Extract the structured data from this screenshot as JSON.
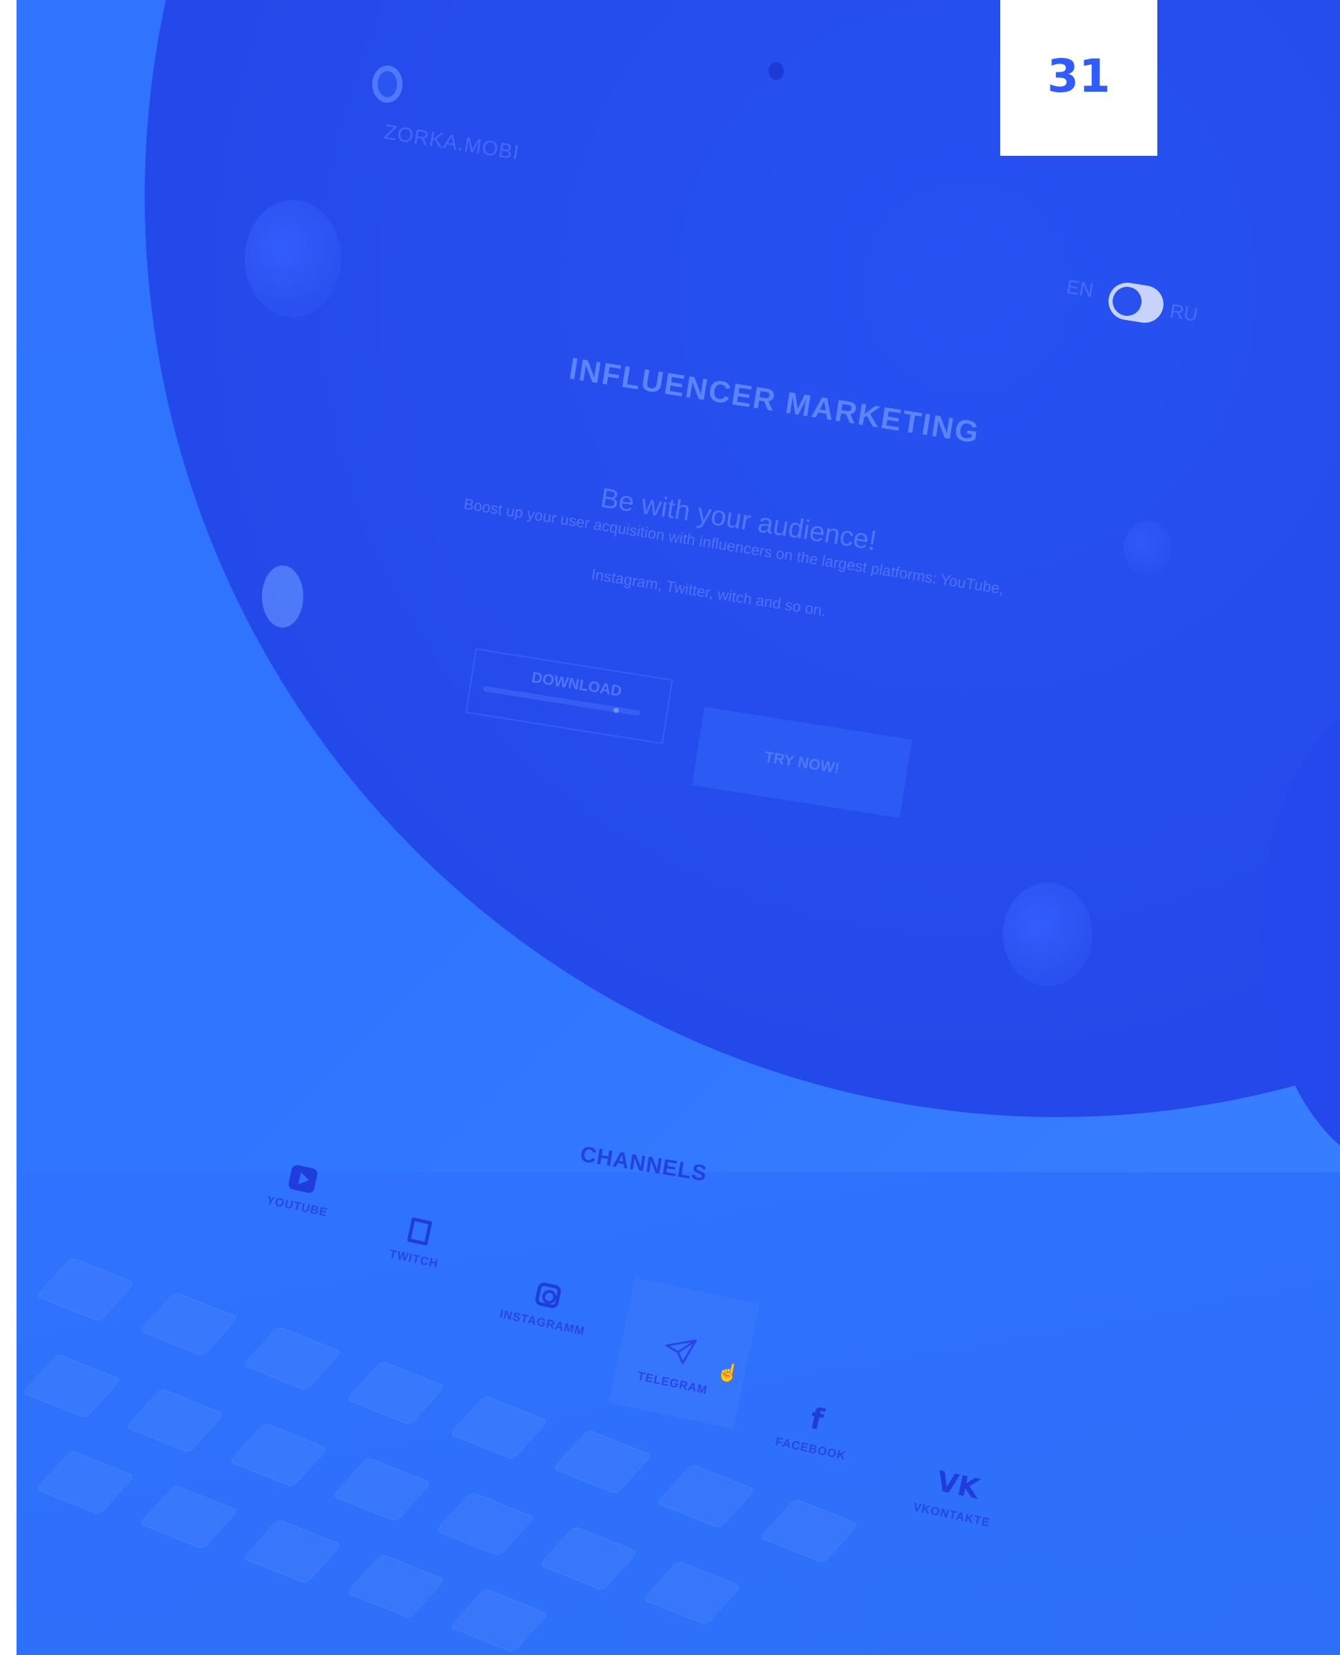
{
  "page_number": "31",
  "brand": {
    "name": "ZORKA.MOBI"
  },
  "language_toggle": {
    "left": "EN",
    "right": "RU"
  },
  "hero": {
    "title": "INFLUENCER MARKETING",
    "subtitle": "Be with your audience!",
    "description_line1": "Boost up your user acquisition with influencers on the largest platforms: YouTube,",
    "description_line2": "Instagram, Twitter, witch and so on.",
    "download_label": "DOWNLOAD",
    "try_label": "TRY NOW!"
  },
  "channels": {
    "title": "CHANNELS",
    "items": [
      {
        "label": "YOUTUBE",
        "icon": "youtube-icon"
      },
      {
        "label": "TWITCH",
        "icon": "twitch-icon"
      },
      {
        "label": "INSTAGRAMM",
        "icon": "instagram-icon"
      },
      {
        "label": "TELEGRAM",
        "icon": "telegram-icon"
      },
      {
        "label": "FACEBOOK",
        "icon": "facebook-icon"
      },
      {
        "label": "VKONTAKTE",
        "icon": "vkontakte-icon"
      }
    ]
  },
  "colors": {
    "background": "#2f73ff",
    "hero_circle": "#2449ea",
    "page_badge_text": "#2f5bff"
  }
}
